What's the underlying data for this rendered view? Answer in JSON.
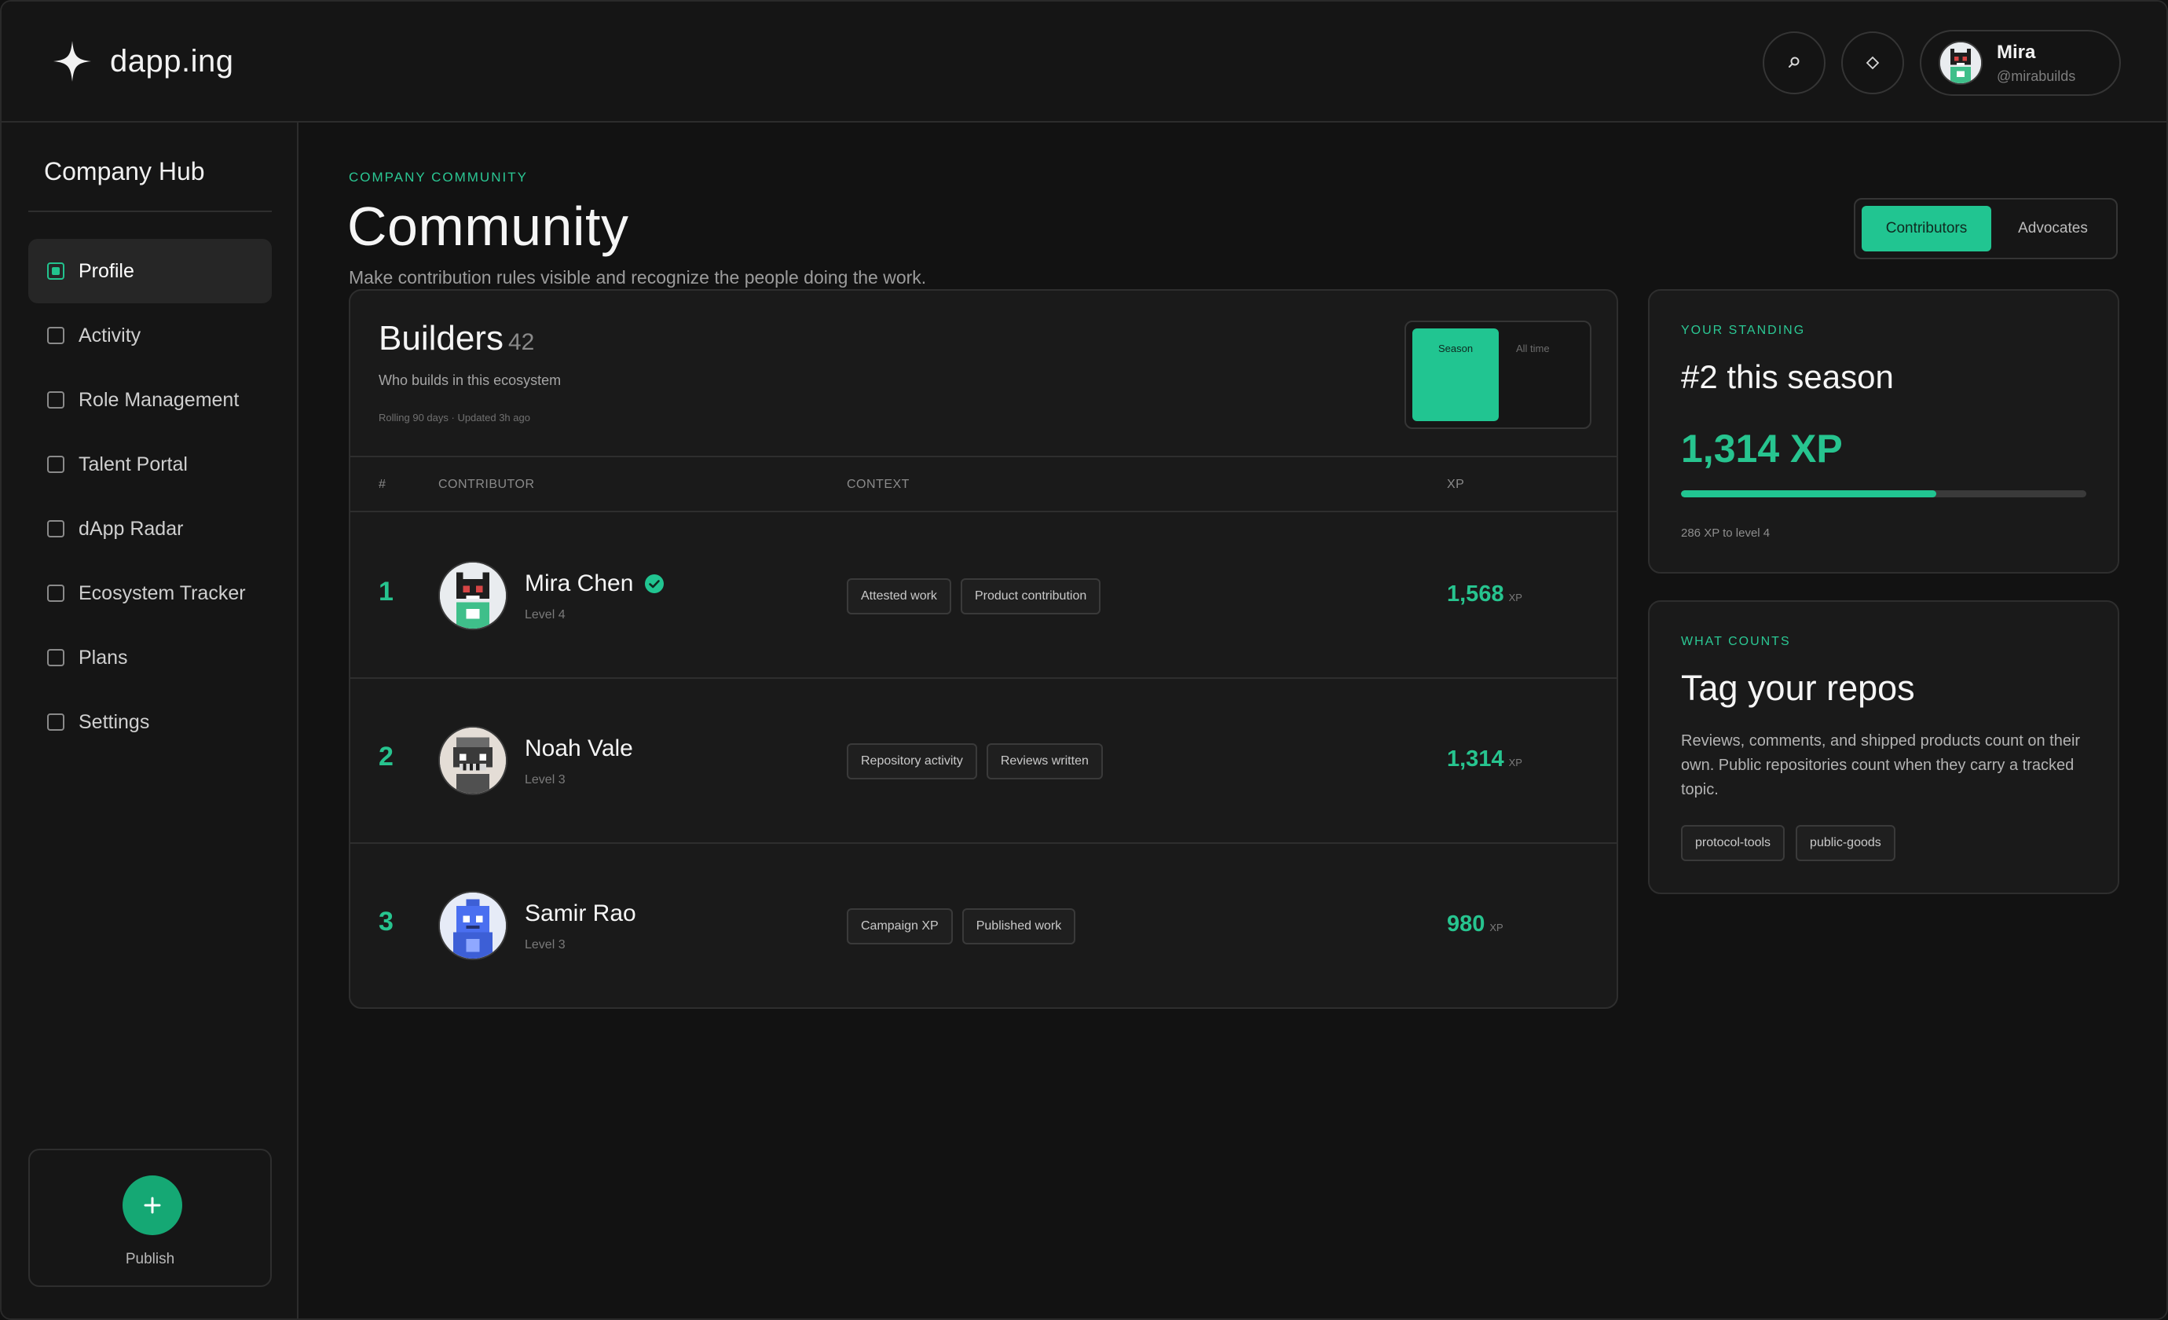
{
  "app": {
    "name": "dapp.ing"
  },
  "header": {
    "search_icon": "search-icon",
    "wallet_icon": "diamond-icon",
    "user": {
      "name": "Mira",
      "handle": "@mirabuilds"
    }
  },
  "sidebar": {
    "title": "Company Hub",
    "items": [
      {
        "label": "Profile",
        "active": true
      },
      {
        "label": "Activity",
        "active": false
      },
      {
        "label": "Role Management",
        "active": false
      },
      {
        "label": "Talent Portal",
        "active": false
      },
      {
        "label": "dApp Radar",
        "active": false
      },
      {
        "label": "Ecosystem Tracker",
        "active": false
      },
      {
        "label": "Plans",
        "active": false
      },
      {
        "label": "Settings",
        "active": false
      }
    ],
    "publish": {
      "icon": "plus-icon",
      "label": "Publish"
    }
  },
  "page": {
    "eyebrow": "COMPANY COMMUNITY",
    "title": "Community",
    "subtitle": "Make contribution rules visible and recognize the people doing the work.",
    "tabs": [
      {
        "label": "Contributors",
        "selected": true
      },
      {
        "label": "Advocates",
        "selected": false
      }
    ]
  },
  "board": {
    "title": "Builders",
    "count": "42",
    "subtitle": "Who builds in this ecosystem",
    "meta": "Rolling 90 days · Updated 3h ago",
    "period": {
      "selected": "Season",
      "other": "All time"
    },
    "columns": {
      "rank": "#",
      "contributor": "CONTRIBUTOR",
      "context": "CONTEXT",
      "xp": "XP"
    },
    "rows": [
      {
        "rank": "1",
        "name": "Mira Chen",
        "verified": true,
        "level": "Level 4",
        "tags": [
          "Attested work",
          "Product contribution"
        ],
        "xp": "1,568",
        "xp_unit": "XP"
      },
      {
        "rank": "2",
        "name": "Noah Vale",
        "verified": false,
        "level": "Level 3",
        "tags": [
          "Repository activity",
          "Reviews written"
        ],
        "xp": "1,314",
        "xp_unit": "XP"
      },
      {
        "rank": "3",
        "name": "Samir Rao",
        "verified": false,
        "level": "Level 3",
        "tags": [
          "Campaign XP",
          "Published work"
        ],
        "xp": "980",
        "xp_unit": "XP"
      }
    ]
  },
  "standing": {
    "eyebrow": "YOUR STANDING",
    "title": "#2 this season",
    "xp": "1,314 XP",
    "progress_fraction": 0.63,
    "footnote": "286 XP to level 4"
  },
  "counts": {
    "eyebrow": "WHAT COUNTS",
    "title": "Tag your repos",
    "body": "Reviews, comments, and shipped products count on their own. Public repositories count when they carry a tracked topic.",
    "tags": [
      "protocol-tools",
      "public-goods"
    ]
  },
  "colors": {
    "accent": "#21c591",
    "background": "#121212",
    "card": "#1a1a1a"
  }
}
